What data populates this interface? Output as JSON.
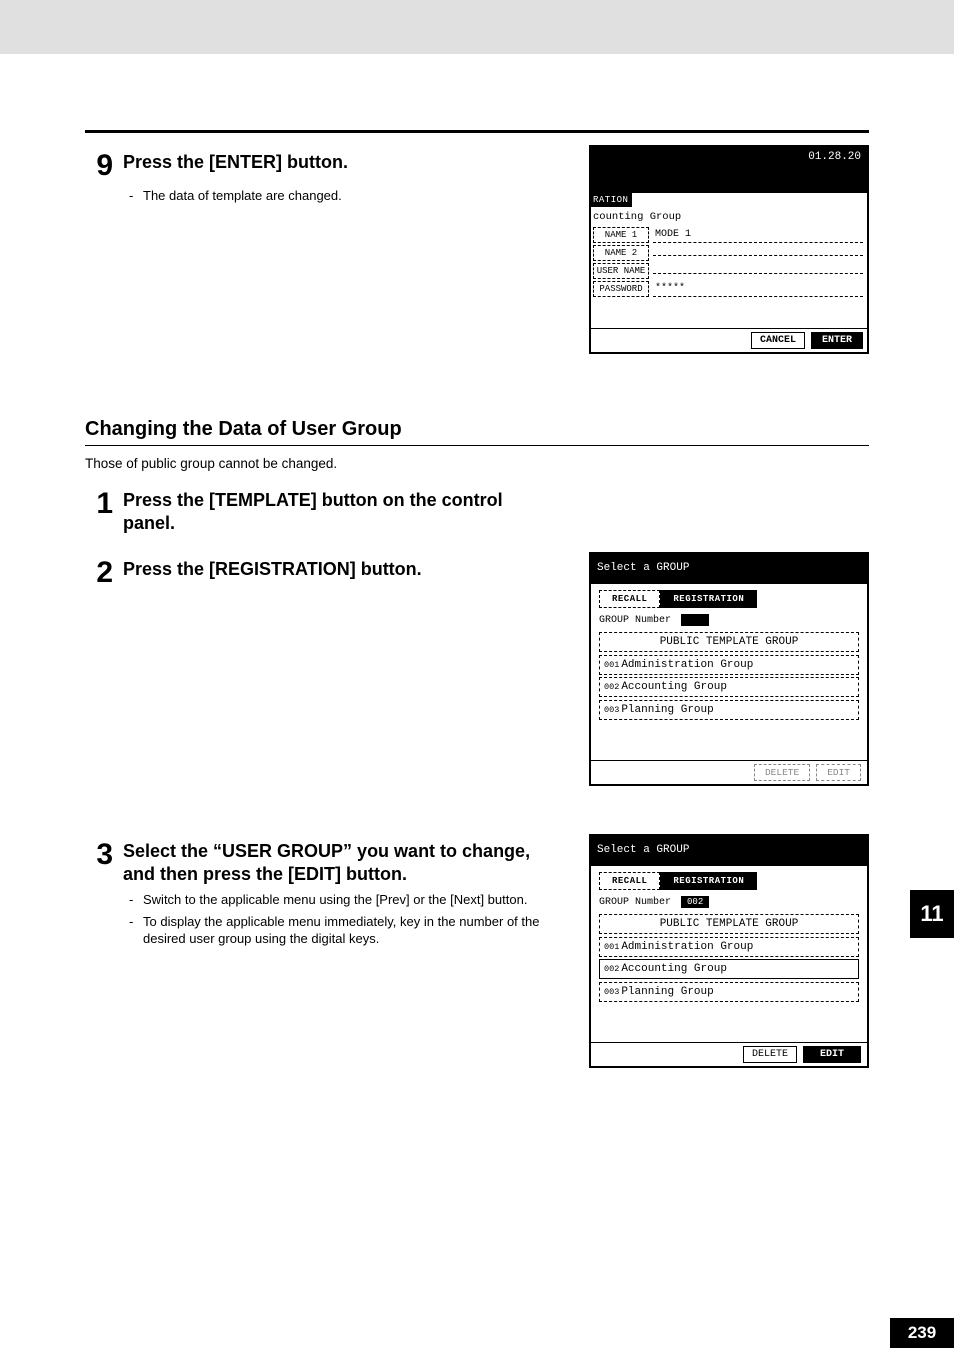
{
  "chapter_tab": "11",
  "page_number": "239",
  "step9": {
    "num": "9",
    "title": "Press the [ENTER] button.",
    "bullets": [
      "The data of template are changed."
    ]
  },
  "screen1": {
    "timestamp": "01.28.20",
    "tab": "RATION",
    "subtitle": "counting Group",
    "rows": [
      {
        "button": "NAME 1",
        "value": "MODE 1"
      },
      {
        "button": "NAME 2",
        "value": ""
      },
      {
        "button": "USER NAME",
        "value": ""
      },
      {
        "button": "PASSWORD",
        "value": "*****"
      }
    ],
    "cancel": "CANCEL",
    "enter": "ENTER"
  },
  "section": {
    "heading": "Changing the Data of User Group",
    "intro": "Those of public group cannot be changed."
  },
  "step1": {
    "num": "1",
    "title": "Press the [TEMPLATE] button on the control panel."
  },
  "step2": {
    "num": "2",
    "title": "Press the [REGISTRATION] button."
  },
  "screen2": {
    "title": "Select a GROUP",
    "recall": "RECALL",
    "registration": "REGISTRATION",
    "group_number_label": "GROUP Number",
    "group_number_value": "",
    "items": [
      {
        "code": "",
        "label": "PUBLIC TEMPLATE GROUP",
        "solid": false
      },
      {
        "code": "001",
        "label": "Administration Group",
        "solid": false
      },
      {
        "code": "002",
        "label": "Accounting Group",
        "solid": false
      },
      {
        "code": "003",
        "label": "Planning Group",
        "solid": false
      }
    ],
    "delete": "DELETE",
    "edit": "EDIT",
    "disabled": true
  },
  "step3": {
    "num": "3",
    "title": "Select the “USER GROUP” you want to change, and then press the [EDIT] button.",
    "bullets": [
      "Switch to the applicable menu using the [Prev] or the [Next] button.",
      "To display the applicable menu immediately, key in the number of the desired user group using the digital keys."
    ]
  },
  "screen3": {
    "title": "Select a GROUP",
    "recall": "RECALL",
    "registration": "REGISTRATION",
    "group_number_label": "GROUP Number",
    "group_number_value": "002",
    "items": [
      {
        "code": "",
        "label": "PUBLIC TEMPLATE GROUP",
        "solid": false
      },
      {
        "code": "001",
        "label": "Administration Group",
        "solid": false
      },
      {
        "code": "002",
        "label": "Accounting Group",
        "solid": true
      },
      {
        "code": "003",
        "label": "Planning Group",
        "solid": false
      }
    ],
    "delete": "DELETE",
    "edit": "EDIT",
    "edit_solid": true
  }
}
